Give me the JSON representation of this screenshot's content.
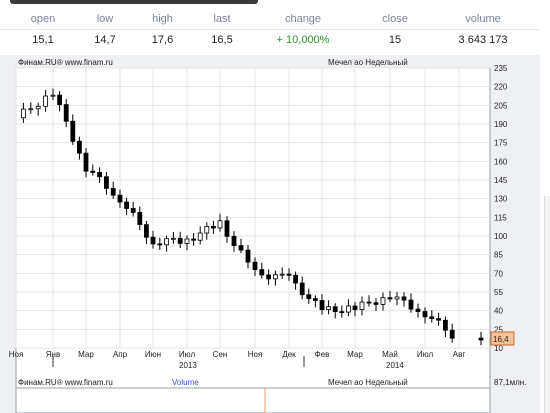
{
  "quote": {
    "headers": [
      "open",
      "low",
      "high",
      "last",
      "change",
      "close",
      "volume"
    ],
    "values": [
      "15,1",
      "14,7",
      "17,6",
      "16,5",
      "+ 10,000%",
      "15",
      "3 643 173"
    ]
  },
  "chart": {
    "source_label": "Финам.RU® www.finam.ru",
    "instrument_label": "Мечел ао Недельный",
    "last_price_badge": "16,4",
    "volume_label": "Volume",
    "volume_max_label": "87,1млн.",
    "y_ticks": [
      "235",
      "220",
      "205",
      "190",
      "175",
      "160",
      "145",
      "130",
      "115",
      "100",
      "85",
      "70",
      "55",
      "40",
      "25",
      "10"
    ],
    "x_ticks": [
      "Ноя",
      "Янв",
      "Мар",
      "Апр",
      "Июн",
      "Июл",
      "Сен",
      "Ноя",
      "Дек",
      "Фев",
      "Мар",
      "Май",
      "Июл",
      "Авг"
    ],
    "year_labels": [
      "2013",
      "2014"
    ],
    "colors": {
      "up": "#ffffff",
      "down": "#000000",
      "grid": "#e5e5e5",
      "badge": "#f4c29a",
      "badge_border": "#c56a2c",
      "quote_header": "#7a8796"
    }
  },
  "chart_data": {
    "type": "line",
    "title": "Мечел ао Недельный",
    "xlabel": "",
    "ylabel": "",
    "ylim": [
      10,
      235
    ],
    "x": [
      "Ноя 2012",
      "Янв 2013",
      "Мар 2013",
      "Апр 2013",
      "Июн 2013",
      "Июл 2013",
      "Сен 2013",
      "Ноя 2013",
      "Дек 2013",
      "Фев 2014",
      "Мар 2014",
      "Май 2014",
      "Июл 2014",
      "Авг 2014"
    ],
    "series": [
      {
        "values": [
          195,
          215,
          155,
          130,
          95,
          97,
          110,
          70,
          66,
          40,
          42,
          52,
          38,
          16.4
        ]
      }
    ],
    "grid": true
  }
}
